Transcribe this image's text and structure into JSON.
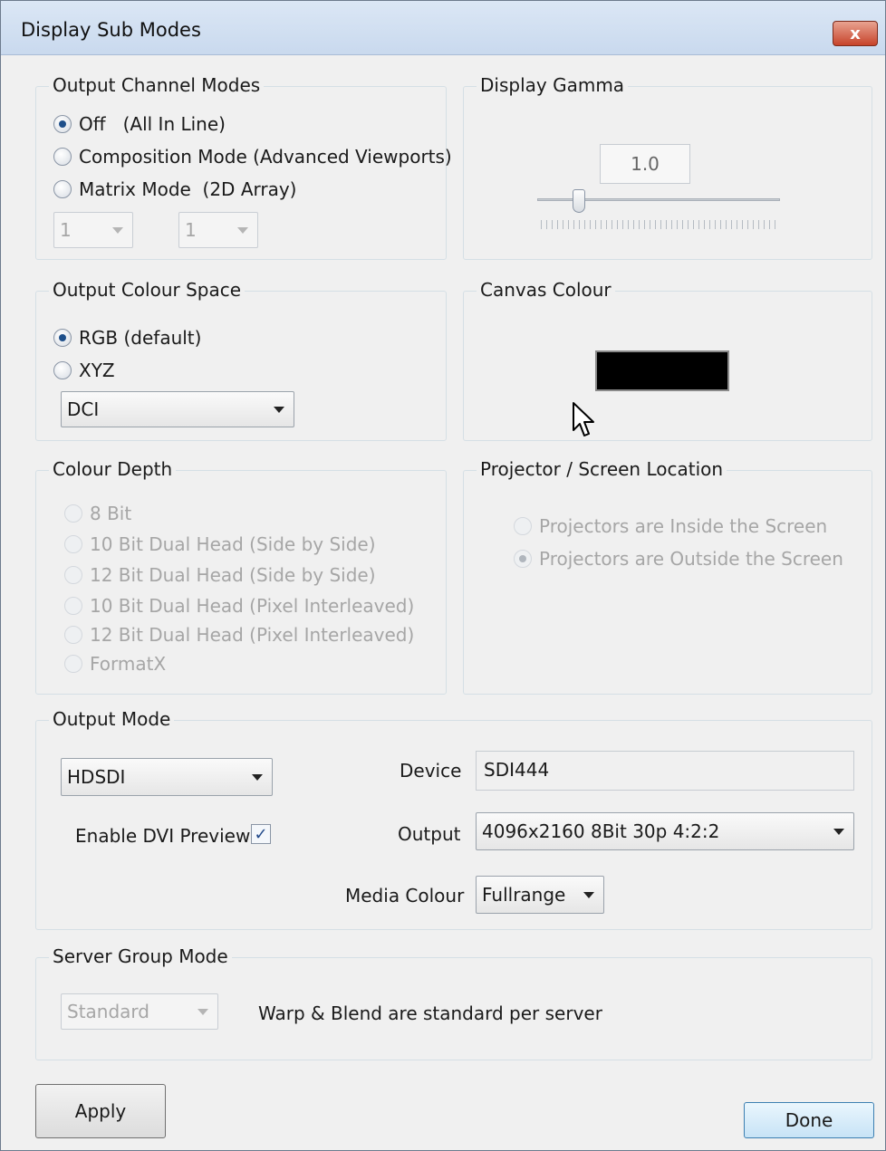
{
  "window": {
    "title": "Display Sub Modes",
    "close_label": "x"
  },
  "output_channel_modes": {
    "title": "Output Channel Modes",
    "options": [
      {
        "label": "Off   (All In Line)",
        "checked": true
      },
      {
        "label": "Composition Mode (Advanced Viewports)",
        "checked": false
      },
      {
        "label": "Matrix Mode  (2D Array)",
        "checked": false
      }
    ],
    "matrix_cols": "1",
    "matrix_rows": "1"
  },
  "display_gamma": {
    "title": "Display Gamma",
    "value": "1.0",
    "slider_level": 0.17
  },
  "output_colour_space": {
    "title": "Output Colour Space",
    "options": [
      {
        "label": "RGB (default)",
        "checked": true
      },
      {
        "label": "XYZ",
        "checked": false
      }
    ],
    "dropdown_value": "DCI"
  },
  "canvas_colour": {
    "title": "Canvas Colour",
    "swatch_color": "#000000"
  },
  "colour_depth": {
    "title": "Colour Depth",
    "options": [
      {
        "label": "8 Bit"
      },
      {
        "label": "10 Bit Dual Head (Side by Side)"
      },
      {
        "label": "12 Bit Dual Head (Side by Side)"
      },
      {
        "label": "10 Bit Dual Head (Pixel Interleaved)"
      },
      {
        "label": "12 Bit Dual Head (Pixel Interleaved)"
      },
      {
        "label": "FormatX"
      }
    ]
  },
  "projector_location": {
    "title": "Projector / Screen Location",
    "options": [
      {
        "label": "Projectors are Inside the Screen",
        "checked": false
      },
      {
        "label": "Projectors are Outside the Screen",
        "checked": true
      }
    ]
  },
  "output_mode": {
    "title": "Output Mode",
    "mode_value": "HDSDI",
    "device_label": "Device",
    "device_value": "SDI444",
    "enable_dvi_label": "Enable DVI Preview",
    "enable_dvi_checked": true,
    "output_label": "Output",
    "output_value": "4096x2160 8Bit 30p 4:2:2",
    "media_colour_label": "Media Colour",
    "media_colour_value": "Fullrange"
  },
  "server_group_mode": {
    "title": "Server Group Mode",
    "dropdown_value": "Standard",
    "description": "Warp & Blend are standard per server"
  },
  "buttons": {
    "apply": "Apply",
    "done": "Done"
  }
}
